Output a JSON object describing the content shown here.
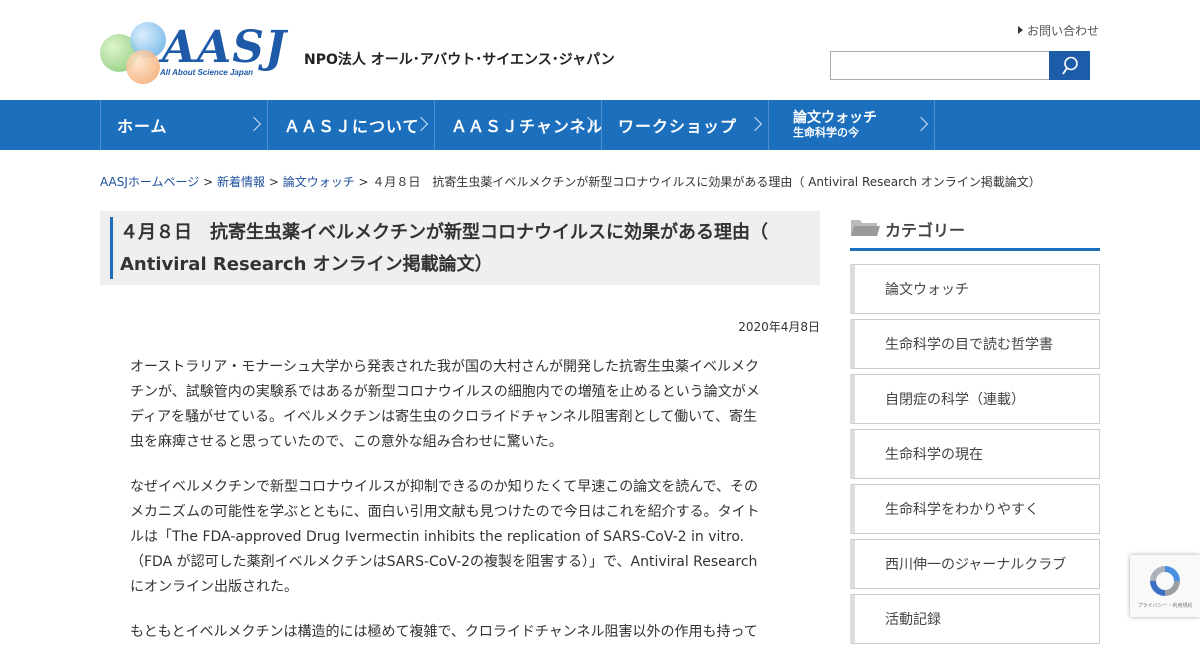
{
  "header": {
    "logo_text": "AASJ",
    "logo_sub": "All About Science Japan",
    "org_name": "NPO法人 オール･アバウト･サイエンス･ジャパン",
    "contact_link": "お問い合わせ",
    "search": {
      "value": "",
      "placeholder": ""
    }
  },
  "nav": {
    "items": [
      {
        "label": "ホーム"
      },
      {
        "label": "ＡＡＳＪについて"
      },
      {
        "label": "ＡＡＳＪチャンネル"
      },
      {
        "label": "ワークショップ"
      },
      {
        "label": "論文ウォッチ",
        "sub": "生命科学の今"
      }
    ]
  },
  "breadcrumb": {
    "home": "AASJホームページ",
    "sep1": " > ",
    "news": "新着情報",
    "sep2": " > ",
    "category": "論文ウォッチ",
    "sep3": " > ",
    "current": "４月８日　抗寄生虫薬イベルメクチンが新型コロナウイルスに効果がある理由（ Antiviral Research オンライン掲載論文）"
  },
  "article": {
    "title": "４月８日　抗寄生虫薬イベルメクチンが新型コロナウイルスに効果がある理由（ Antiviral Research オンライン掲載論文）",
    "date": "2020年4月8日",
    "paragraphs": [
      "オーストラリア・モナーシュ大学から発表された我が国の大村さんが開発した抗寄生虫薬イベルメクチンが、試験管内の実験系ではあるが新型コロナウイルスの細胞内での増殖を止めるという論文がメディアを騒がせている。イベルメクチンは寄生虫のクロライドチャンネル阻害剤として働いて、寄生虫を麻痺させると思っていたので、この意外な組み合わせに驚いた。",
      "なぜイベルメクチンで新型コロナウイルスが抑制できるのか知りたくて早速この論文を読んで、そのメカニズムの可能性を学ぶとともに、面白い引用文献も見つけたので今日はこれを紹介する。タイトルは「The FDA-approved Drug Ivermectin inhibits the replication of SARS-CoV-2 in vitro. （FDA が認可した薬剤イベルメクチンはSARS-CoV-2の複製を阻害する）」で、Antiviral Researchにオンライン出版された。",
      "もともとイベルメクチンは構造的には極めて複雑で、クロライドチャンネル阻害以外の作用も持って"
    ]
  },
  "sidebar": {
    "category_title": "カテゴリー",
    "categories": [
      "論文ウォッチ",
      "生命科学の目で読む哲学書",
      "自閉症の科学（連載）",
      "生命科学の現在",
      "生命科学をわかりやすく",
      "西川伸一のジャーナルクラブ",
      "活動記録"
    ]
  },
  "recaptcha": {
    "text": "プライバシー・利用規約"
  },
  "colors": {
    "nav_blue": "#1c6fbd",
    "link_blue": "#1e4f9c",
    "search_button": "#1c5ca8"
  }
}
